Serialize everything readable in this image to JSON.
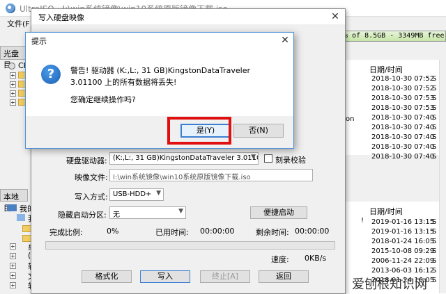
{
  "main_window": {
    "title": "UltraISO - I:\\win系统镜像\\win10系统原版镜像下载.iso",
    "menu_file": "文件(F)",
    "size_info": "% of 8.5GB - 3349MB free",
    "save_label": "保存",
    "disc_panel_label": "光盘目",
    "disc_root": "CP",
    "local_panel_label": "本地目",
    "local_tree": [
      "我的",
      "我"
    ],
    "local_tree_lower": [
      "桌",
      "(C",
      "软",
      "文",
      "软"
    ],
    "list_header": "日期/时间",
    "list_rows_top": [
      "2018-10-30 07:52",
      "2018-10-30 07:52",
      "2018-10-30 07:53",
      "2018-10-30 07:53",
      "2018-10-30 07:40",
      "2018-10-30 07:40",
      "2018-10-30 07:40",
      "2018-10-30 07:40",
      "2018-10-30 07:40"
    ],
    "list_suffix_top": [
      "S",
      "S",
      "S",
      "S",
      "S",
      "S",
      "S",
      "S",
      "S"
    ],
    "list_mid_fragment": "on",
    "list_header_2": "日期/时间",
    "list_rows_bottom": [
      "2019-01-16 13:15",
      "2019-01-16 13:15",
      "2018-01-24 16:05",
      "2015-10-08 09:29",
      "2006-11-24 22:09",
      "2013-06-03 16:12",
      "2018-01-24 16:05"
    ],
    "list_suffix_bottom": [
      "S",
      "S",
      "S",
      "S",
      "S",
      "S",
      "S"
    ],
    "list_exclaim": "!",
    "watermark": "爱刨根知识网"
  },
  "write_dialog": {
    "title": "写入硬盘映像",
    "drive_label": "硬盘驱动器:",
    "drive_value": "(K:,L:, 31 GB)KingstonDataTraveler 3.0110",
    "verify_label": "刻录校验",
    "image_label": "映像文件:",
    "image_value": "I:\\win系统镜像\\win10系统原版镜像下载.iso",
    "method_label": "写入方式:",
    "method_value": "USB-HDD+",
    "hide_label": "隐藏启动分区:",
    "hide_value": "无",
    "quick_boot": "便捷启动",
    "progress_label": "完成比例:",
    "progress_value": "0%",
    "elapsed_label": "已用时间:",
    "elapsed_value": "00:00:00",
    "remaining_label": "剩余时间:",
    "remaining_value": "00:00:00",
    "progress_fraction": 0,
    "speed_label": "速度:",
    "speed_value": "0KB/s",
    "format_btn": "格式化",
    "write_btn": "写入",
    "stop_btn": "终止[A]",
    "back_btn": "返回"
  },
  "prompt_dialog": {
    "title": "提示",
    "warning": "警告! 驱动器 (K:,L:, 31 GB)KingstonDataTraveler 3.01100 上的所有数据将丢失!",
    "confirm": "您确定继续操作吗?",
    "yes": "是(Y)",
    "no": "否(N)",
    "icon_glyph": "?"
  },
  "colors": {
    "highlight": "#e01010",
    "accent": "#3c7fd1"
  }
}
